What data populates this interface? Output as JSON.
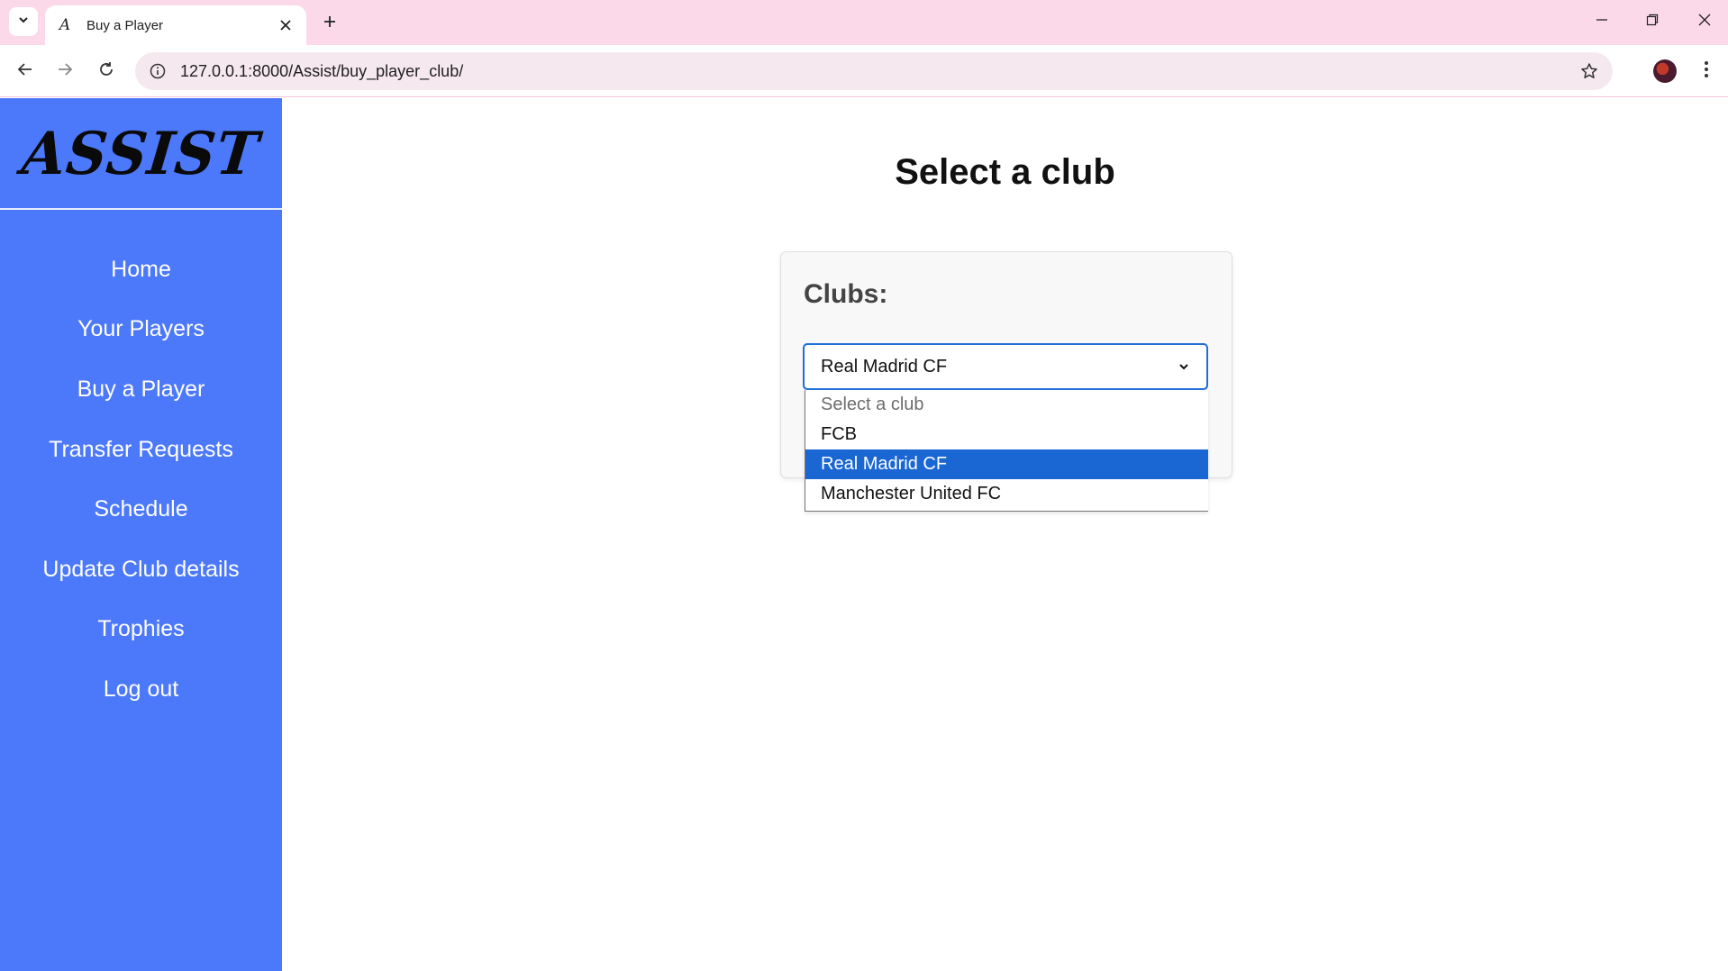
{
  "browser": {
    "tab_title": "Buy a Player",
    "tab_favicon": "A",
    "url": "127.0.0.1:8000/Assist/buy_player_club/"
  },
  "sidebar": {
    "logo": "ASSIST",
    "items": [
      {
        "label": "Home"
      },
      {
        "label": "Your Players"
      },
      {
        "label": "Buy a Player"
      },
      {
        "label": "Transfer Requests"
      },
      {
        "label": "Schedule"
      },
      {
        "label": "Update Club details"
      },
      {
        "label": "Trophies"
      },
      {
        "label": "Log out"
      }
    ]
  },
  "main": {
    "title": "Select a club",
    "form": {
      "label": "Clubs:",
      "selected": "Real Madrid CF",
      "options": [
        {
          "label": "Select a club"
        },
        {
          "label": "FCB"
        },
        {
          "label": "Real Madrid CF"
        },
        {
          "label": "Manchester United FC"
        }
      ]
    }
  },
  "colors": {
    "sidebar": "#4c78fa",
    "tabbar": "#fbd9e9",
    "option_highlight": "#1a66d2"
  }
}
